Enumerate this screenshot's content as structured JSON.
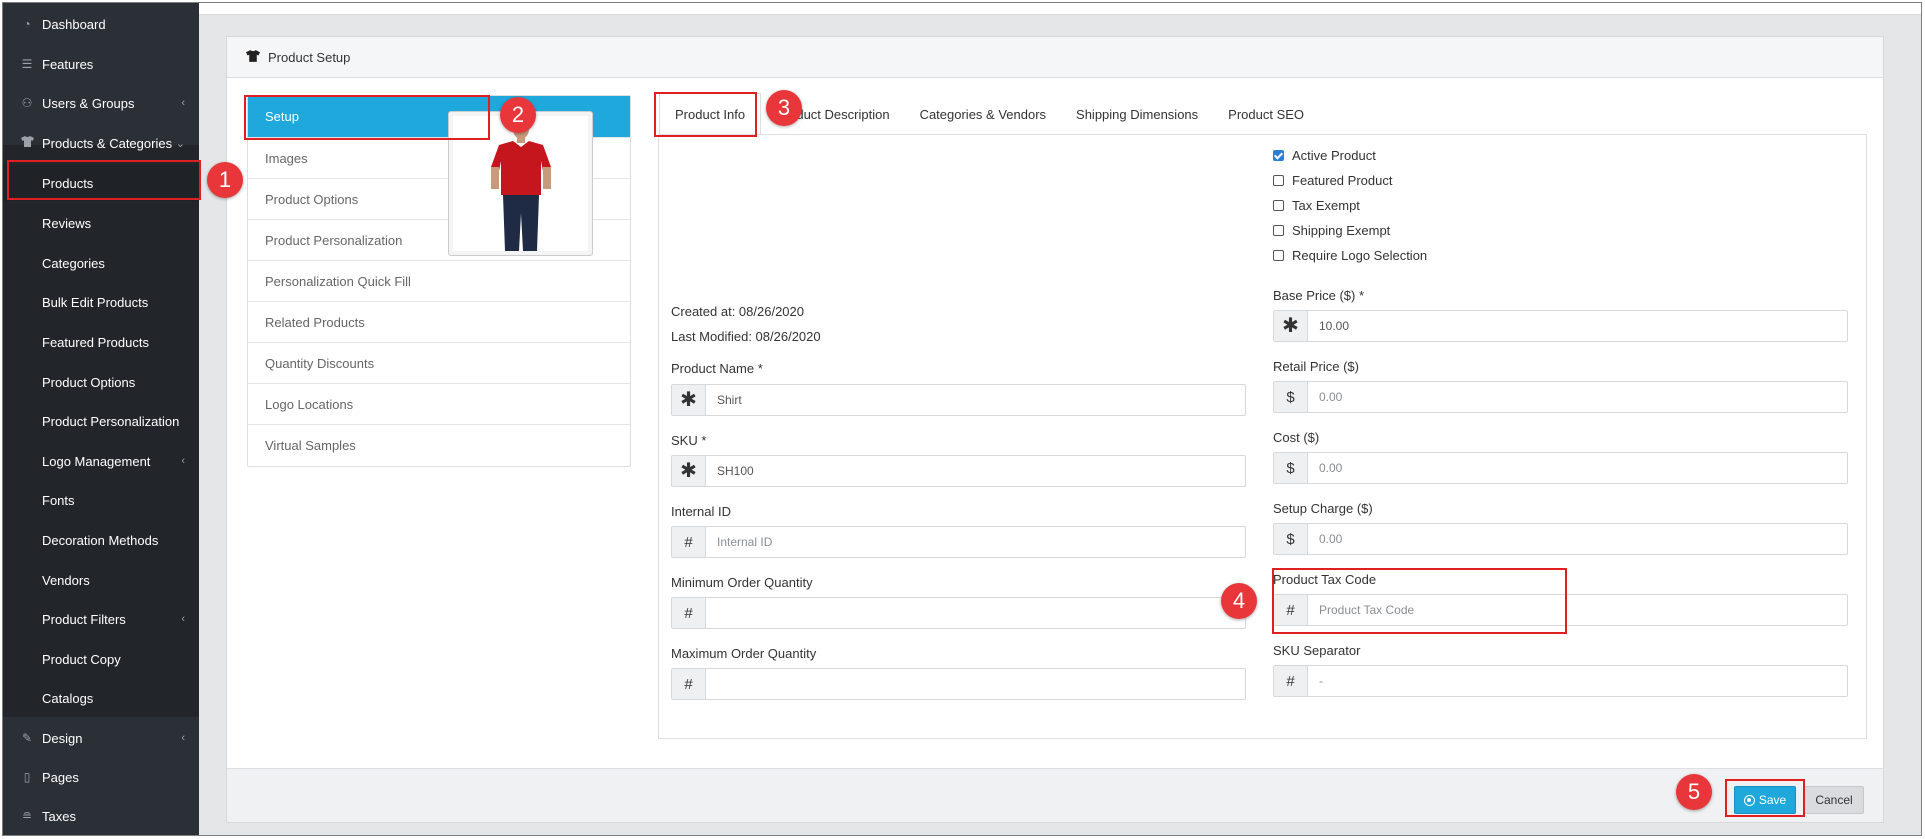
{
  "sidebar": {
    "items": [
      {
        "label": "Dashboard",
        "icon": "dashboard-icon"
      },
      {
        "label": "Features",
        "icon": "list-icon"
      },
      {
        "label": "Users & Groups",
        "icon": "users-icon",
        "caret": "‹"
      },
      {
        "label": "Products & Categories",
        "icon": "shirt-icon",
        "caret": "⌄"
      },
      {
        "label": "Products"
      },
      {
        "label": "Reviews"
      },
      {
        "label": "Categories"
      },
      {
        "label": "Bulk Edit Products"
      },
      {
        "label": "Featured Products"
      },
      {
        "label": "Product Options"
      },
      {
        "label": "Product Personalization"
      },
      {
        "label": "Logo Management",
        "caret": "‹"
      },
      {
        "label": "Fonts"
      },
      {
        "label": "Decoration Methods"
      },
      {
        "label": "Vendors"
      },
      {
        "label": "Product Filters",
        "caret": "‹"
      },
      {
        "label": "Product Copy"
      },
      {
        "label": "Catalogs"
      },
      {
        "label": "Design",
        "icon": "brush-icon",
        "caret": "‹"
      },
      {
        "label": "Pages",
        "icon": "page-icon"
      },
      {
        "label": "Taxes",
        "icon": "coins-icon"
      }
    ]
  },
  "panel": {
    "title": "Product Setup"
  },
  "setup_list": [
    "Setup",
    "Images",
    "Product Options",
    "Product Personalization",
    "Personalization Quick Fill",
    "Related Products",
    "Quantity Discounts",
    "Logo Locations",
    "Virtual Samples"
  ],
  "tabs": [
    "Product Info",
    "Product Description",
    "Categories & Vendors",
    "Shipping Dimensions",
    "Product SEO"
  ],
  "product_info": {
    "created_at": "Created at: 08/26/2020",
    "last_modified": "Last Modified: 08/26/2020",
    "product_name_label": "Product Name *",
    "product_name_value": "Shirt",
    "sku_label": "SKU *",
    "sku_value": "SH100",
    "internal_id_label": "Internal ID",
    "internal_id_placeholder": "Internal ID",
    "min_qty_label": "Minimum Order Quantity",
    "max_qty_label": "Maximum Order Quantity",
    "checkboxes": [
      {
        "label": "Active Product",
        "checked": true
      },
      {
        "label": "Featured Product",
        "checked": false
      },
      {
        "label": "Tax Exempt",
        "checked": false
      },
      {
        "label": "Shipping Exempt",
        "checked": false
      },
      {
        "label": "Require Logo Selection",
        "checked": false
      }
    ],
    "base_price_label": "Base Price ($) *",
    "base_price_value": "10.00",
    "retail_price_label": "Retail Price ($)",
    "retail_price_placeholder": "0.00",
    "cost_label": "Cost ($)",
    "cost_placeholder": "0.00",
    "setup_charge_label": "Setup Charge ($)",
    "setup_charge_placeholder": "0.00",
    "tax_code_label": "Product Tax Code",
    "tax_code_placeholder": "Product Tax Code",
    "sku_separator_label": "SKU Separator",
    "sku_separator_placeholder": "-"
  },
  "addons": {
    "star": "✱",
    "hash": "#",
    "dollar": "$"
  },
  "buttons": {
    "save": "Save",
    "cancel": "Cancel"
  },
  "markers": [
    "1",
    "2",
    "3",
    "4",
    "5"
  ],
  "colors": {
    "accent": "#1fa8dc",
    "sidebar_bg": "#2b3036",
    "annotation_red": "#e02020"
  }
}
